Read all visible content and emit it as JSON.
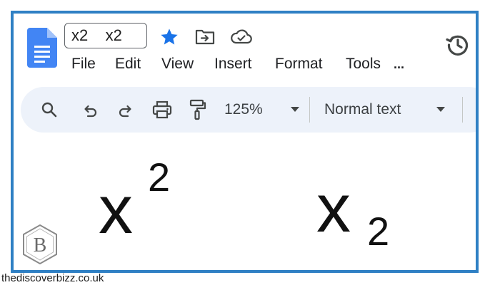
{
  "header": {
    "title": "x2    x2",
    "app_icon": "google-docs-icon",
    "icons": [
      "star-icon",
      "move-to-folder-icon",
      "cloud-saved-icon",
      "version-history-icon"
    ]
  },
  "menu": {
    "items": [
      "File",
      "Edit",
      "View",
      "Insert",
      "Format",
      "Tools",
      "..."
    ]
  },
  "toolbar": {
    "icons": [
      "search-icon",
      "undo-icon",
      "redo-icon",
      "print-icon",
      "paint-format-icon"
    ],
    "zoom": "125%",
    "paragraph_style": "Normal text"
  },
  "document": {
    "superscript_example": {
      "base": "x",
      "script": "2"
    },
    "subscript_example": {
      "base": "x",
      "script": "2"
    }
  },
  "watermark": {
    "logo_letter": "B",
    "site": "thediscoverbizz.co.uk"
  },
  "colors": {
    "frame_border": "#2f80c4",
    "docs_blue": "#4285f4",
    "star_blue": "#1a73e8",
    "toolbar_bg": "#edf2fa"
  }
}
